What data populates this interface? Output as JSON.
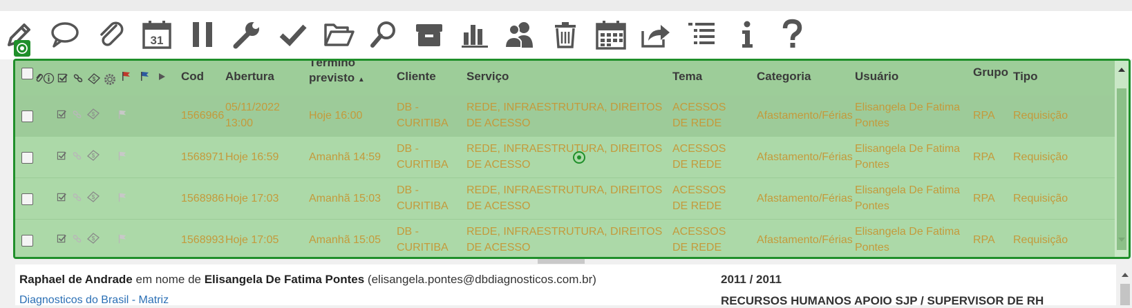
{
  "toolbar": {
    "icons": [
      "pencil-icon",
      "speech-bubble-icon",
      "paperclip-icon",
      "calendar-31-icon",
      "pause-icon",
      "wrench-icon",
      "checkmark-icon",
      "folder-open-icon",
      "magnifier-icon",
      "archive-box-icon",
      "bar-chart-icon",
      "users-icon",
      "trash-icon",
      "calendar-grid-icon",
      "share-icon",
      "list-icon",
      "info-icon",
      "help-icon"
    ],
    "calendar_day": "31"
  },
  "grid": {
    "columns": {
      "cod": "Cod",
      "abertura": "Abertura",
      "termino": "Término previsto",
      "cliente": "Cliente",
      "servico": "Serviço",
      "tema": "Tema",
      "categoria": "Categoria",
      "usuario": "Usuário",
      "grupo": "Grupo",
      "tipo": "Tipo"
    },
    "sort_indicator": "▲",
    "rows": [
      {
        "cod": "1566966",
        "abertura": "05/11/2022 13:00",
        "termino": "Hoje 16:00",
        "cliente": "DB - CURITIBA",
        "servico": "REDE, INFRAESTRUTURA, DIREITOS DE ACESSO",
        "tema": "ACESSOS DE REDE",
        "categoria": "Afastamento/Férias",
        "usuario": "Elisangela De Fatima Pontes",
        "grupo": "RPA",
        "tipo": "Requisição"
      },
      {
        "cod": "1568971",
        "abertura": "Hoje 16:59",
        "termino": "Amanhã 14:59",
        "cliente": "DB - CURITIBA",
        "servico": "REDE, INFRAESTRUTURA, DIREITOS DE ACESSO",
        "tema": "ACESSOS DE REDE",
        "categoria": "Afastamento/Férias",
        "usuario": "Elisangela De Fatima Pontes",
        "grupo": "RPA",
        "tipo": "Requisição"
      },
      {
        "cod": "1568986",
        "abertura": "Hoje 17:03",
        "termino": "Amanhã 15:03",
        "cliente": "DB - CURITIBA",
        "servico": "REDE, INFRAESTRUTURA, DIREITOS DE ACESSO",
        "tema": "ACESSOS DE REDE",
        "categoria": "Afastamento/Férias",
        "usuario": "Elisangela De Fatima Pontes",
        "grupo": "RPA",
        "tipo": "Requisição"
      },
      {
        "cod": "1568993",
        "abertura": "Hoje 17:05",
        "termino": "Amanhã 15:05",
        "cliente": "DB - CURITIBA",
        "servico": "REDE, INFRAESTRUTURA, DIREITOS DE ACESSO",
        "tema": "ACESSOS DE REDE",
        "categoria": "Afastamento/Férias",
        "usuario": "Elisangela De Fatima Pontes",
        "grupo": "RPA",
        "tipo": "Requisição"
      }
    ]
  },
  "detail": {
    "author": "Raphael de Andrade",
    "on_behalf": "em nome de",
    "requester": "Elisangela De Fatima Pontes",
    "email": "(elisangela.pontes@dbdiagnosticos.com.br)",
    "company_link": "Diagnosticos do Brasil - Matriz",
    "extension": "2011 / 2011",
    "department": "RECURSOS HUMANOS APOIO SJP / SUPERVISOR DE RH"
  },
  "colors": {
    "selection_border": "#1f8f2a",
    "row_text": "#c49a3b",
    "grid_bg": "#a9d8a6",
    "link": "#2a6fb5"
  }
}
